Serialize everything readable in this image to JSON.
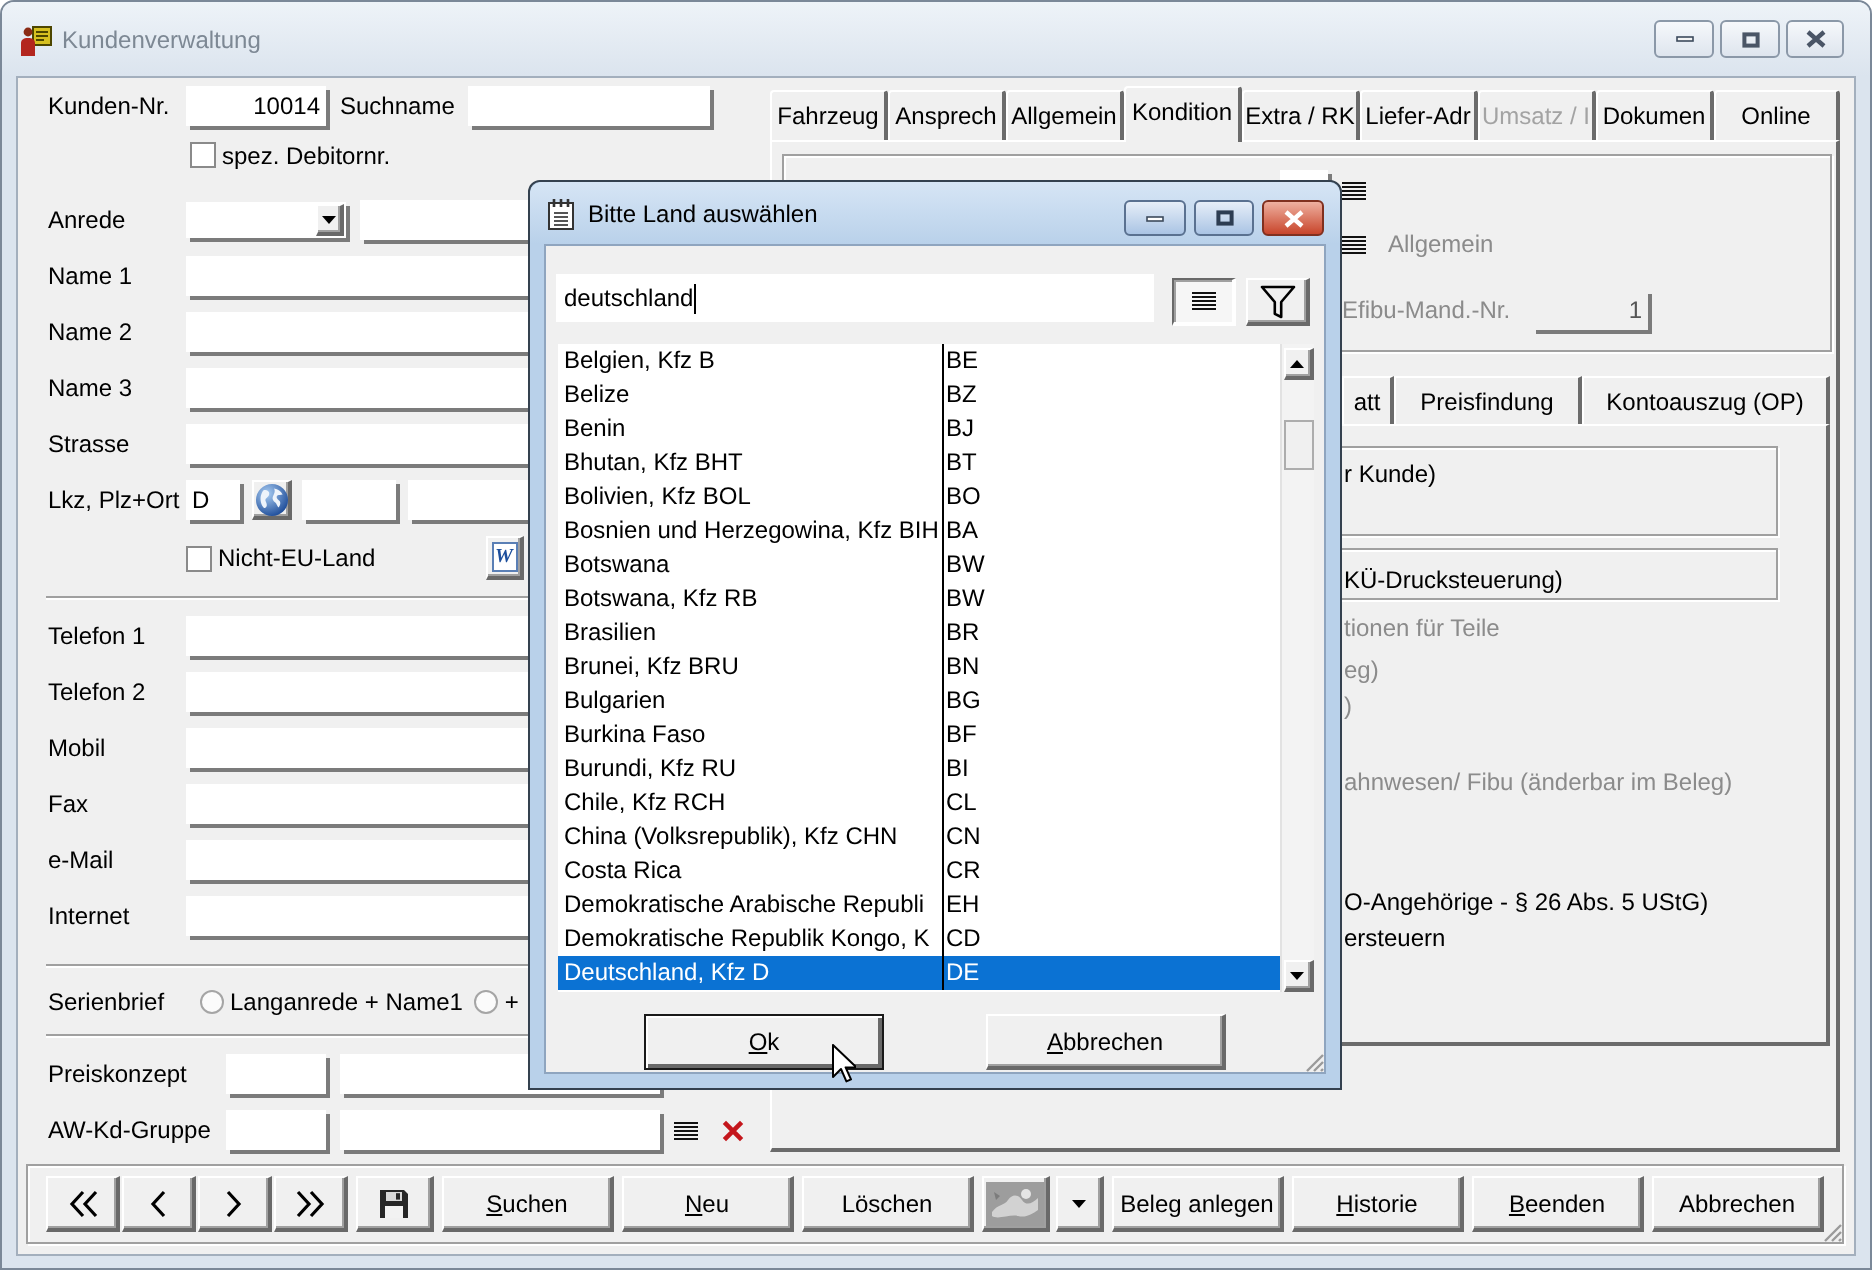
{
  "window": {
    "title": "Kundenverwaltung",
    "active": false
  },
  "customer_form": {
    "customer_no": {
      "label": "Kunden-Nr.",
      "value": "10014"
    },
    "search_name": {
      "label": "Suchname"
    },
    "special_debtor": {
      "label": "spez. Debitornr.",
      "checked": false
    },
    "salutation": {
      "label": "Anrede"
    },
    "address_fields": [
      {
        "label": "Name 1"
      },
      {
        "label": "Name 2"
      },
      {
        "label": "Name 3"
      },
      {
        "label": "Strasse"
      }
    ],
    "location": {
      "label": "Lkz, Plz+Ort",
      "country_code": "D"
    },
    "non_eu": {
      "label": "Nicht-EU-Land",
      "checked": false
    },
    "word_button": {
      "glyph": "W"
    },
    "contact_fields": [
      {
        "label": "Telefon 1"
      },
      {
        "label": "Telefon 2"
      },
      {
        "label": "Mobil"
      },
      {
        "label": "Fax"
      },
      {
        "label": "e-Mail"
      },
      {
        "label": "Internet"
      }
    ],
    "serial_letter": {
      "label": "Serienbrief",
      "options": [
        {
          "label": "Langanrede + Name1",
          "selected": false
        },
        {
          "label": "+",
          "selected": false
        }
      ]
    },
    "price_concept": {
      "label": "Preiskonzept"
    },
    "aw_group": {
      "label": "AW-Kd-Gruppe"
    }
  },
  "tabs": [
    {
      "label": "Fahrzeug",
      "selected": false,
      "disabled": false
    },
    {
      "label": "Ansprech",
      "selected": false,
      "disabled": false
    },
    {
      "label": "Allgemein",
      "selected": false,
      "disabled": false
    },
    {
      "label": "Kondition",
      "selected": true,
      "disabled": false
    },
    {
      "label": "Extra / RK",
      "selected": false,
      "disabled": false
    },
    {
      "label": "Liefer-Adr",
      "selected": false,
      "disabled": false
    },
    {
      "label": "Umsatz / I",
      "selected": false,
      "disabled": true
    },
    {
      "label": "Dokumen",
      "selected": false,
      "disabled": false
    },
    {
      "label": "Online",
      "selected": false,
      "disabled": false
    }
  ],
  "condition_page": {
    "lookup_label": {
      "text": "Allgemein",
      "disabled": true
    },
    "efibu": {
      "label": "Efibu-Mand.-Nr.",
      "value": "1",
      "disabled": true
    },
    "subtabs": [
      {
        "label": "att",
        "selected": false
      },
      {
        "label": "Preisfindung",
        "selected": false
      },
      {
        "label": "Kontoauszug (OP)",
        "selected": false
      }
    ],
    "subpage_items": [
      {
        "kind": "group",
        "text": "r Kunde)"
      },
      {
        "kind": "group",
        "text": "KÜ-Drucksteuerung)"
      },
      {
        "kind": "label",
        "text": "tionen für Teile",
        "disabled": true
      },
      {
        "kind": "label",
        "text": "eg)",
        "disabled": true
      },
      {
        "kind": "label",
        "text": ")",
        "disabled": true
      },
      {
        "kind": "label",
        "text": "ahnwesen/ Fibu (änderbar im Beleg)",
        "disabled": true
      },
      {
        "kind": "label",
        "text": "O-Angehörige - § 26 Abs. 5 UStG)",
        "disabled": false
      },
      {
        "kind": "label",
        "text": "ersteuern",
        "disabled": false
      }
    ]
  },
  "dialog": {
    "title": "Bitte Land auswählen",
    "active": true,
    "search": {
      "value": "deutschland",
      "focused": true
    },
    "view_buttons": [
      {
        "kind": "list",
        "pressed": true
      },
      {
        "kind": "filter",
        "pressed": false
      }
    ],
    "list": {
      "rows": [
        {
          "name": "Belgien, Kfz B",
          "code": "BE",
          "selected": false
        },
        {
          "name": "Belize",
          "code": "BZ",
          "selected": false
        },
        {
          "name": "Benin",
          "code": "BJ",
          "selected": false
        },
        {
          "name": "Bhutan, Kfz BHT",
          "code": "BT",
          "selected": false
        },
        {
          "name": "Bolivien, Kfz BOL",
          "code": "BO",
          "selected": false
        },
        {
          "name": "Bosnien und Herzegowina, Kfz BIH",
          "code": "BA",
          "selected": false
        },
        {
          "name": "Botswana",
          "code": "BW",
          "selected": false
        },
        {
          "name": "Botswana, Kfz RB",
          "code": "BW",
          "selected": false
        },
        {
          "name": "Brasilien",
          "code": "BR",
          "selected": false
        },
        {
          "name": "Brunei, Kfz BRU",
          "code": "BN",
          "selected": false
        },
        {
          "name": "Bulgarien",
          "code": "BG",
          "selected": false
        },
        {
          "name": "Burkina Faso",
          "code": "BF",
          "selected": false
        },
        {
          "name": "Burundi, Kfz RU",
          "code": "BI",
          "selected": false
        },
        {
          "name": "Chile, Kfz RCH",
          "code": "CL",
          "selected": false
        },
        {
          "name": "China (Volksrepublik), Kfz CHN",
          "code": "CN",
          "selected": false
        },
        {
          "name": "Costa Rica",
          "code": "CR",
          "selected": false
        },
        {
          "name": "Demokratische Arabische Republi",
          "code": "EH",
          "selected": false
        },
        {
          "name": "Demokratische Republik Kongo, K",
          "code": "CD",
          "selected": false
        },
        {
          "name": "Deutschland, Kfz D",
          "code": "DE",
          "selected": true
        }
      ]
    },
    "buttons": [
      {
        "label": "Ok",
        "mnemonic": true,
        "default": true
      },
      {
        "label": "Abbrechen",
        "mnemonic": true,
        "default": false
      }
    ]
  },
  "toolbar": {
    "buttons": [
      {
        "kind": "first"
      },
      {
        "kind": "previous"
      },
      {
        "kind": "next"
      },
      {
        "kind": "last"
      },
      {
        "kind": "save"
      },
      {
        "kind": "text",
        "label": "Suchen",
        "mnemonic": true
      },
      {
        "kind": "text",
        "label": "Neu",
        "mnemonic": true
      },
      {
        "kind": "text",
        "label": "Löschen",
        "mnemonic": false
      },
      {
        "kind": "image",
        "disabled": true
      },
      {
        "kind": "dropdown"
      },
      {
        "kind": "text",
        "label": "Beleg anlegen",
        "mnemonic": false
      },
      {
        "kind": "text",
        "label": "Historie",
        "mnemonic": true
      },
      {
        "kind": "text",
        "label": "Beenden",
        "mnemonic": true
      },
      {
        "kind": "text",
        "label": "Abbrechen",
        "mnemonic": false
      }
    ]
  }
}
